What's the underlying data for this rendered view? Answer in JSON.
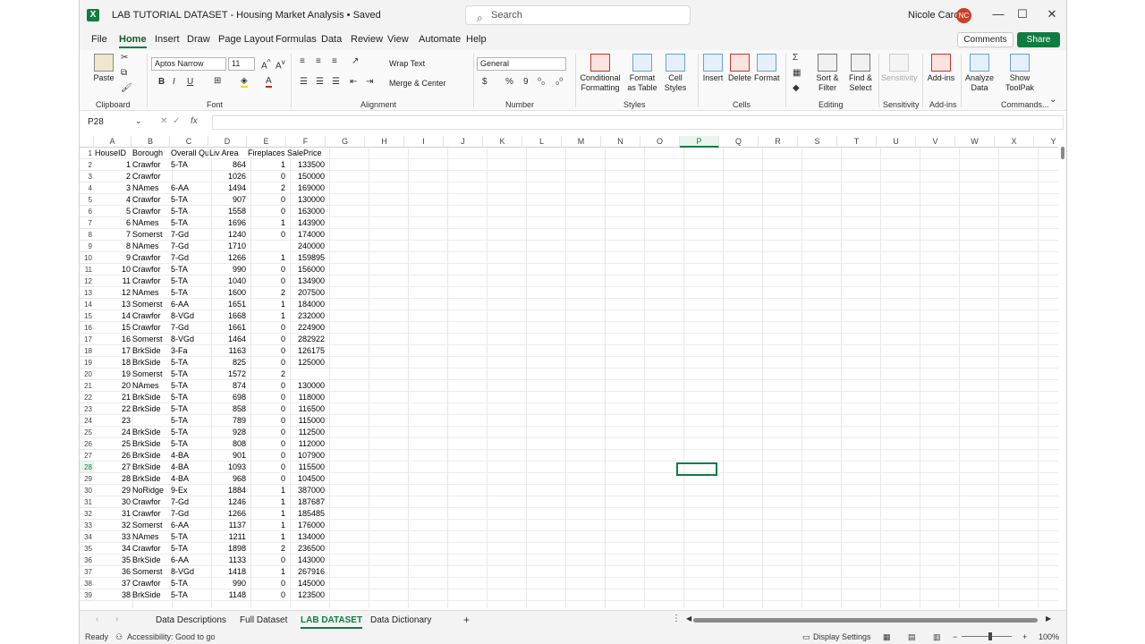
{
  "app": {
    "title": "LAB TUTORIAL DATASET - Housing Market Analysis • Saved",
    "search_placeholder": "Search",
    "user_name": "Nicole Carder",
    "user_initials": "NC"
  },
  "menu": [
    "File",
    "Home",
    "Insert",
    "Draw",
    "Page Layout",
    "Formulas",
    "Data",
    "Review",
    "View",
    "Automate",
    "Help"
  ],
  "menu_active": "Home",
  "buttons": {
    "comments": "Comments",
    "share": "Share"
  },
  "ribbon": {
    "paste": "Paste",
    "clipboard": "Clipboard",
    "font_name": "Aptos Narrow",
    "font_size": "11",
    "font": "Font",
    "wrap_text": "Wrap Text",
    "merge_center": "Merge & Center",
    "alignment": "Alignment",
    "number_format": "General",
    "number": "Number",
    "conditional_formatting": "Conditional Formatting",
    "format_as_table": "Format as Table",
    "cell_styles": "Cell Styles",
    "styles": "Styles",
    "insert": "Insert",
    "delete": "Delete",
    "format": "Format",
    "cells": "Cells",
    "sort_filter": "Sort & Filter",
    "find_select": "Find & Select",
    "editing": "Editing",
    "sensitivity_btn": "Sensitivity",
    "sensitivity": "Sensitivity",
    "addins_btn": "Add-ins",
    "addins": "Add-ins",
    "analyze_data": "Analyze Data",
    "show_toolpak": "Show ToolPak",
    "commands": "Commands..."
  },
  "formula_bar": {
    "name_box": "P28",
    "fx": "fx",
    "value": ""
  },
  "columns": [
    "A",
    "B",
    "C",
    "D",
    "E",
    "F",
    "G",
    "H",
    "I",
    "J",
    "K",
    "L",
    "M",
    "N",
    "O",
    "P",
    "Q",
    "R",
    "S",
    "T",
    "U",
    "V",
    "W",
    "X",
    "Y"
  ],
  "selected_column": "P",
  "selected_row": "28",
  "headers": [
    "HouseID",
    "Borough",
    "Overall Qu",
    "Liv Area",
    "Fireplaces",
    "SalePrice"
  ],
  "rows": [
    [
      "1",
      "Crawfor",
      "5-TA",
      "864",
      "1",
      "133500"
    ],
    [
      "2",
      "Crawfor",
      "",
      "1026",
      "0",
      "150000"
    ],
    [
      "3",
      "NAmes",
      "6-AA",
      "1494",
      "2",
      "169000"
    ],
    [
      "4",
      "Crawfor",
      "5-TA",
      "907",
      "0",
      "130000"
    ],
    [
      "5",
      "Crawfor",
      "5-TA",
      "1558",
      "0",
      "163000"
    ],
    [
      "6",
      "NAmes",
      "5-TA",
      "1696",
      "1",
      "143900"
    ],
    [
      "7",
      "Somerst",
      "7-Gd",
      "1240",
      "0",
      "174000"
    ],
    [
      "8",
      "NAmes",
      "7-Gd",
      "1710",
      "",
      "240000"
    ],
    [
      "9",
      "Crawfor",
      "7-Gd",
      "1266",
      "1",
      "159895"
    ],
    [
      "10",
      "Crawfor",
      "5-TA",
      "990",
      "0",
      "156000"
    ],
    [
      "11",
      "Crawfor",
      "5-TA",
      "1040",
      "0",
      "134900"
    ],
    [
      "12",
      "NAmes",
      "5-TA",
      "1600",
      "2",
      "207500"
    ],
    [
      "13",
      "Somerst",
      "6-AA",
      "1651",
      "1",
      "184000"
    ],
    [
      "14",
      "Crawfor",
      "8-VGd",
      "1668",
      "1",
      "232000"
    ],
    [
      "15",
      "Crawfor",
      "7-Gd",
      "1661",
      "0",
      "224900"
    ],
    [
      "16",
      "Somerst",
      "8-VGd",
      "1464",
      "0",
      "282922"
    ],
    [
      "17",
      "BrkSide",
      "3-Fa",
      "1163",
      "0",
      "126175"
    ],
    [
      "18",
      "BrkSide",
      "5-TA",
      "825",
      "0",
      "125000"
    ],
    [
      "19",
      "Somerst",
      "5-TA",
      "1572",
      "2",
      ""
    ],
    [
      "20",
      "NAmes",
      "5-TA",
      "874",
      "0",
      "130000"
    ],
    [
      "21",
      "BrkSide",
      "5-TA",
      "698",
      "0",
      "118000"
    ],
    [
      "22",
      "BrkSide",
      "5-TA",
      "858",
      "0",
      "116500"
    ],
    [
      "23",
      "",
      "5-TA",
      "789",
      "0",
      "115000"
    ],
    [
      "24",
      "BrkSide",
      "5-TA",
      "928",
      "0",
      "112500"
    ],
    [
      "25",
      "BrkSide",
      "5-TA",
      "808",
      "0",
      "112000"
    ],
    [
      "26",
      "BrkSide",
      "4-BA",
      "901",
      "0",
      "107900"
    ],
    [
      "27",
      "BrkSide",
      "4-BA",
      "1093",
      "0",
      "115500"
    ],
    [
      "28",
      "BrkSide",
      "4-BA",
      "968",
      "0",
      "104500"
    ],
    [
      "29",
      "NoRidge",
      "9-Ex",
      "1884",
      "1",
      "387000"
    ],
    [
      "30",
      "Crawfor",
      "7-Gd",
      "1246",
      "1",
      "187687"
    ],
    [
      "31",
      "Crawfor",
      "7-Gd",
      "1266",
      "1",
      "185485"
    ],
    [
      "32",
      "Somerst",
      "6-AA",
      "1137",
      "1",
      "176000"
    ],
    [
      "33",
      "NAmes",
      "5-TA",
      "1211",
      "1",
      "134000"
    ],
    [
      "34",
      "Crawfor",
      "5-TA",
      "1898",
      "2",
      "236500"
    ],
    [
      "35",
      "BrkSide",
      "6-AA",
      "1133",
      "0",
      "143000"
    ],
    [
      "36",
      "Somerst",
      "8-VGd",
      "1418",
      "1",
      "267916"
    ],
    [
      "37",
      "Crawfor",
      "5-TA",
      "990",
      "0",
      "145000"
    ],
    [
      "38",
      "BrkSide",
      "5-TA",
      "1148",
      "0",
      "123500"
    ]
  ],
  "sheet_tabs": [
    "Data Descriptions",
    "Full Dataset",
    "LAB DATASET",
    "Data Dictionary"
  ],
  "active_sheet": "LAB DATASET",
  "status": {
    "ready": "Ready",
    "accessibility": "Accessibility: Good to go",
    "display_settings": "Display Settings",
    "zoom": "100%"
  }
}
